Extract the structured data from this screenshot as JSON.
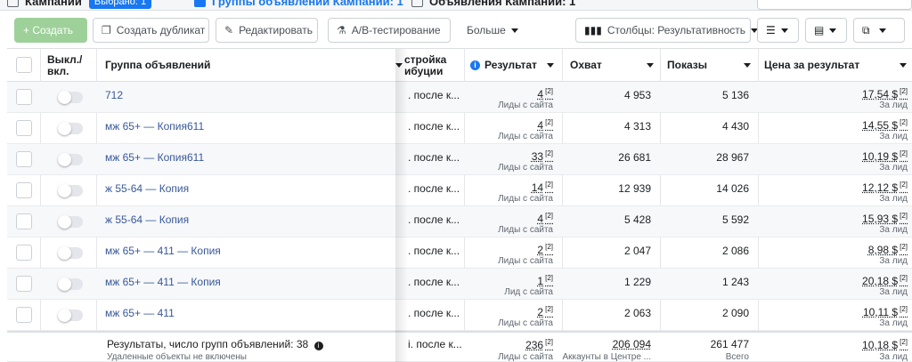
{
  "tabs": {
    "campaigns": "Кампании",
    "selected_badge": "Выбрано: 1",
    "adsets": "Группы объявлений Кампании: 1",
    "ads": "Объявления Кампании: 1"
  },
  "toolbar": {
    "create": "+ Создать",
    "duplicate": "Создать дубликат",
    "edit": "Редактировать",
    "ab_test": "A/B-тестирование",
    "more": "Больше",
    "columns": "Столбцы: Результативность"
  },
  "columns": {
    "onoff": "Выкл./ вкл.",
    "adset": "Группа объявлений",
    "attribution": "стройка ибуции",
    "result": "Результат",
    "reach": "Охват",
    "impressions": "Показы",
    "cost_per_result": "Цена за результат"
  },
  "rows": [
    {
      "name": "712",
      "attr": ". после к...",
      "result": "4",
      "result_sub": "Лиды с сайта",
      "reach": "4 953",
      "impressions": "5 136",
      "cost": "17,54 $",
      "cost_sub": "За лид"
    },
    {
      "name": "мж 65+ — Копия611",
      "attr": ". после к...",
      "result": "4",
      "result_sub": "Лиды с сайта",
      "reach": "4 313",
      "impressions": "4 430",
      "cost": "14,55 $",
      "cost_sub": "За лид"
    },
    {
      "name": "мж 65+ — Копия611",
      "attr": ". после к...",
      "result": "33",
      "result_sub": "Лиды с сайта",
      "reach": "26 681",
      "impressions": "28 967",
      "cost": "10,19 $",
      "cost_sub": "За лид"
    },
    {
      "name": "ж 55-64 — Копия",
      "attr": ". после к...",
      "result": "14",
      "result_sub": "Лиды с сайта",
      "reach": "12 939",
      "impressions": "14 026",
      "cost": "12,12 $",
      "cost_sub": "За лид"
    },
    {
      "name": "ж 55-64 — Копия",
      "attr": ". после к...",
      "result": "4",
      "result_sub": "Лиды с сайта",
      "reach": "5 428",
      "impressions": "5 592",
      "cost": "15,93 $",
      "cost_sub": "За лид"
    },
    {
      "name": "мж 65+ — 411 — Копия",
      "attr": ". после к...",
      "result": "2",
      "result_sub": "Лиды с сайта",
      "reach": "2 047",
      "impressions": "2 086",
      "cost": "8,98 $",
      "cost_sub": "За лид"
    },
    {
      "name": "мж 65+ — 411 — Копия",
      "attr": ". после к...",
      "result": "1",
      "result_sub": "Лид с сайта",
      "reach": "1 229",
      "impressions": "1 243",
      "cost": "20,18 $",
      "cost_sub": "За лид"
    },
    {
      "name": "мж 65+ — 411",
      "attr": ". после к...",
      "result": "2",
      "result_sub": "Лиды с сайта",
      "reach": "2 063",
      "impressions": "2 090",
      "cost": "10,11 $",
      "cost_sub": "За лид"
    }
  ],
  "footnote_marker": "[2]",
  "summary": {
    "label": "Результаты, число групп объявлений: 38",
    "note": "Удаленные объекты не включены",
    "attr": "і. после к...",
    "result": "236",
    "result_sub": "Лиды с сайта",
    "reach": "206 094",
    "reach_sub": "Аккаунты в Центре ...",
    "impressions": "261 477",
    "impressions_sub": "Всего",
    "cost": "10,18 $",
    "cost_sub": "За лид"
  },
  "colors": {
    "accent": "#1877f2",
    "link": "#385898",
    "create_button": "#9ed09a"
  }
}
